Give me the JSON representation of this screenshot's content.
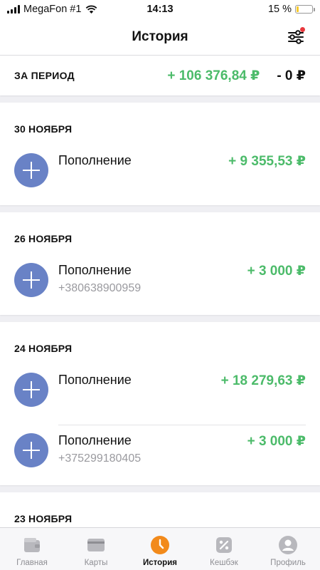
{
  "status_bar": {
    "carrier": "MegaFon #1",
    "time": "14:13",
    "battery_text": "15 %",
    "battery_level": 0.15
  },
  "header": {
    "title": "История",
    "filter_icon": "sliders-icon"
  },
  "period": {
    "label": "ЗА ПЕРИОД",
    "income": "+ 106 376,84 ₽",
    "expense": "- 0 ₽"
  },
  "groups": [
    {
      "date": "30 НОЯБРЯ",
      "transactions": [
        {
          "title": "Пополнение",
          "subtitle": "",
          "amount": "+ 9 355,53 ₽"
        }
      ]
    },
    {
      "date": "26 НОЯБРЯ",
      "transactions": [
        {
          "title": "Пополнение",
          "subtitle": "+380638900959",
          "amount": "+ 3 000 ₽"
        }
      ]
    },
    {
      "date": "24 НОЯБРЯ",
      "transactions": [
        {
          "title": "Пополнение",
          "subtitle": "",
          "amount": "+ 18 279,63 ₽"
        },
        {
          "title": "Пополнение",
          "subtitle": "+375299180405",
          "amount": "+ 3 000 ₽"
        }
      ]
    },
    {
      "date": "23 НОЯБРЯ",
      "transactions": []
    }
  ],
  "tabs": [
    {
      "label": "Главная",
      "icon": "wallet-icon",
      "active": false
    },
    {
      "label": "Карты",
      "icon": "card-icon",
      "active": false
    },
    {
      "label": "История",
      "icon": "clock-icon",
      "active": true
    },
    {
      "label": "Кешбэк",
      "icon": "percent-icon",
      "active": false
    },
    {
      "label": "Профиль",
      "icon": "user-icon",
      "active": false
    }
  ],
  "colors": {
    "income": "#4cbb6a",
    "accent": "#f28a1b",
    "transaction_icon": "#6982c6",
    "notification_dot": "#e8383d"
  }
}
